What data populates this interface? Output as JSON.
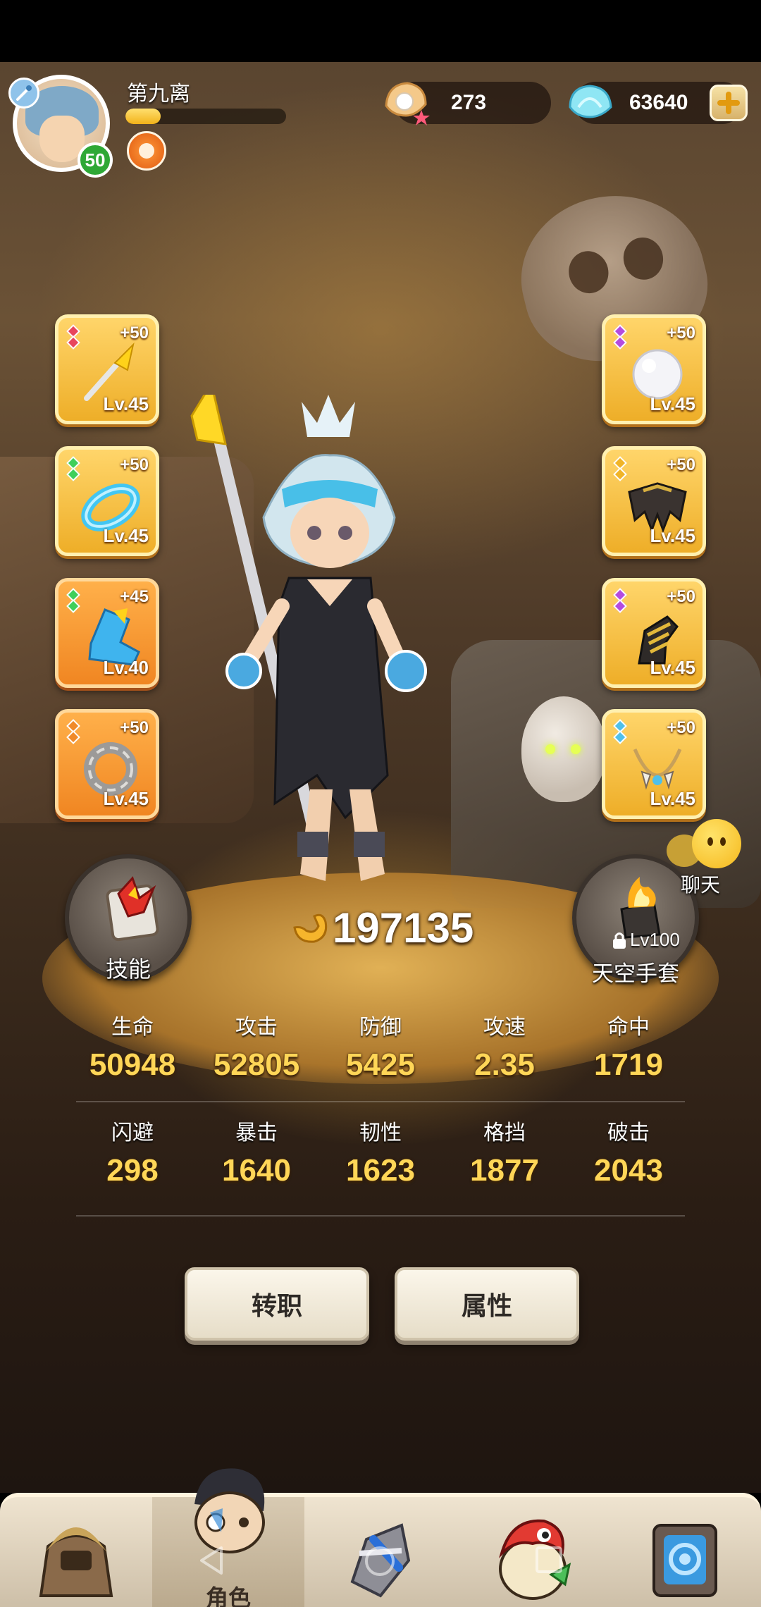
{
  "player": {
    "name": "第九离",
    "level": "50",
    "xp_fraction": 0.22
  },
  "currency": {
    "shells": "273",
    "gems": "63640"
  },
  "equipment": {
    "left": [
      {
        "plus": "+50",
        "level": "Lv.45",
        "item": "golden-spear-icon",
        "gem_color": "#e8455c"
      },
      {
        "plus": "+50",
        "level": "Lv.45",
        "item": "ice-bracelet-icon",
        "gem_color": "#3fcf5a"
      },
      {
        "plus": "+45",
        "level": "Lv.40",
        "item": "blue-boot-icon",
        "gem_color": "#3fcf5a"
      },
      {
        "plus": "+50",
        "level": "Lv.45",
        "item": "stone-ring-icon",
        "gem_color": "#f08a2a"
      }
    ],
    "right": [
      {
        "plus": "+50",
        "level": "Lv.45",
        "item": "pearl-icon",
        "gem_color": "#b44be0"
      },
      {
        "plus": "+50",
        "level": "Lv.45",
        "item": "feather-cape-icon",
        "gem_color": "#f0b428"
      },
      {
        "plus": "+50",
        "level": "Lv.45",
        "item": "claw-gauntlet-icon",
        "gem_color": "#b44be0"
      },
      {
        "plus": "+50",
        "level": "Lv.45",
        "item": "fang-necklace-icon",
        "gem_color": "#4fc0ea"
      }
    ]
  },
  "power": "197135",
  "buttons": {
    "skill": "技能",
    "glove_lock": "Lv100",
    "glove": "天空手套",
    "chat": "聊天",
    "job_change": "转职",
    "attributes": "属性"
  },
  "stats": [
    [
      {
        "label": "生命",
        "value": "50948"
      },
      {
        "label": "攻击",
        "value": "52805"
      },
      {
        "label": "防御",
        "value": "5425"
      },
      {
        "label": "攻速",
        "value": "2.35"
      },
      {
        "label": "命中",
        "value": "1719"
      }
    ],
    [
      {
        "label": "闪避",
        "value": "298"
      },
      {
        "label": "暴击",
        "value": "1640"
      },
      {
        "label": "韧性",
        "value": "1623"
      },
      {
        "label": "格挡",
        "value": "1877"
      },
      {
        "label": "破击",
        "value": "2043"
      }
    ]
  ],
  "nav": [
    {
      "label": "",
      "icon": "caveman-hut-icon"
    },
    {
      "label": "角色",
      "icon": "character-face-icon",
      "active": true
    },
    {
      "label": "",
      "icon": "battle-sword-icon"
    },
    {
      "label": "",
      "icon": "dino-egg-icon"
    },
    {
      "label": "",
      "icon": "stone-portal-icon"
    }
  ],
  "colors": {
    "stat_value": "#ffd657",
    "slot_gold": "#eeae28",
    "slot_orange": "#f08622",
    "level_badge": "#2ea836"
  }
}
